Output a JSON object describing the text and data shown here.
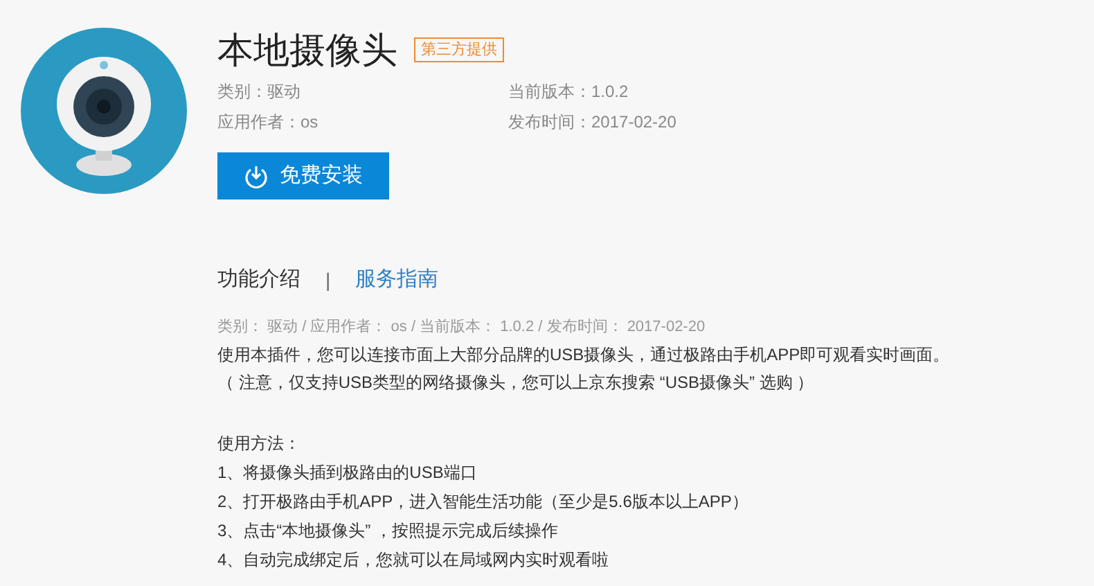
{
  "app": {
    "title": "本地摄像头",
    "badge": "第三方提供",
    "meta": [
      {
        "label": "类别：驱动"
      },
      {
        "label": "当前版本：1.0.2"
      },
      {
        "label": "应用作者：os"
      },
      {
        "label": "发布时间：2017-02-20"
      }
    ],
    "install_button": "免费安装"
  },
  "tabs": [
    {
      "label": "功能介绍",
      "selected": true
    },
    {
      "label": "服务指南",
      "selected": false
    }
  ],
  "tab_separator": "|",
  "summary": "类别： 驱动 / 应用作者： os / 当前版本： 1.0.2 / 发布时间： 2017-02-20",
  "description": [
    "使用本插件，您可以连接市面上大部分品牌的USB摄像头，通过极路由手机APP即可观看实时画面。",
    "（ 注意，仅支持USB类型的网络摄像头，您可以上京东搜索 “USB摄像头” 选购 ）"
  ],
  "usage": {
    "heading": "使用方法：",
    "steps": [
      "1、将摄像头插到极路由的USB端口",
      "2、打开极路由手机APP，进入智能生活功能（至少是5.6版本以上APP）",
      "3、点击“本地摄像头” ，按照提示完成后续操作",
      "4、自动完成绑定后，您就可以在局域网内实时观看啦"
    ]
  }
}
